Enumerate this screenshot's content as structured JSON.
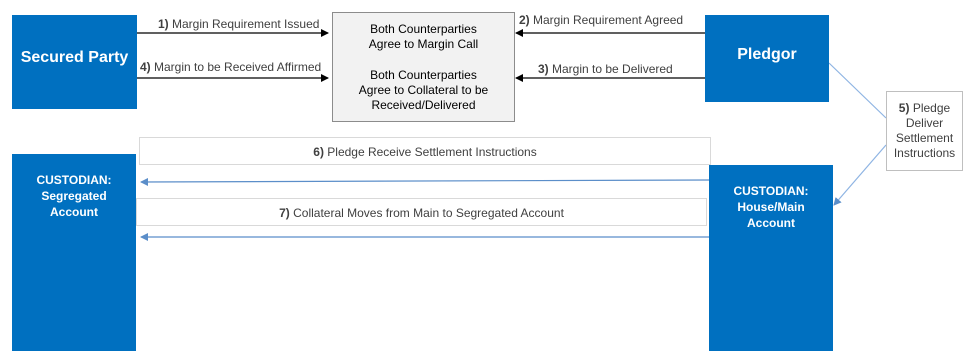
{
  "parties": {
    "secured_party": "Secured Party",
    "pledgor": "Pledgor",
    "custodian_segregated": [
      "CUSTODIAN:",
      "Segregated",
      "Account"
    ],
    "custodian_house": [
      "CUSTODIAN:",
      "House/Main",
      "Account"
    ]
  },
  "center": {
    "line1": [
      "Both Counterparties",
      "Agree to Margin Call"
    ],
    "line2": [
      "Both Counterparties",
      "Agree to Collateral to be",
      "Received/Delivered"
    ]
  },
  "steps": {
    "s1": {
      "num": "1)",
      "text": " Margin Requirement Issued"
    },
    "s2": {
      "num": "2)",
      "text": " Margin Requirement Agreed"
    },
    "s3": {
      "num": "3)",
      "text": " Margin to be Delivered"
    },
    "s4": {
      "num": "4)",
      "text": " Margin to be Received Affirmed"
    },
    "s5": {
      "num": "5)",
      "text": [
        "Pledge",
        "Deliver",
        "Settlement",
        "Instructions"
      ]
    },
    "s6": {
      "num": "6)",
      "text": " Pledge Receive Settlement Instructions"
    },
    "s7": {
      "num": "7)",
      "text": " Collateral Moves from Main to Segregated Account"
    }
  },
  "colors": {
    "box_blue": "#0070c0",
    "connector_blue": "#8eb4e3",
    "arrow_black": "#000000"
  }
}
